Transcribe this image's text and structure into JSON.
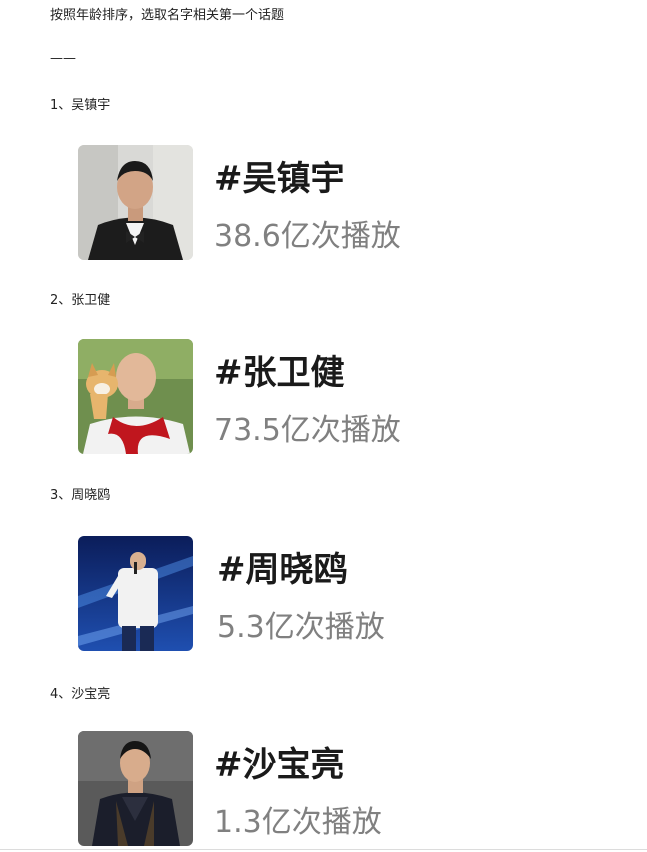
{
  "intro_text": "按照年龄排序，选取名字相关第一个话题",
  "divider_text": "——",
  "items": [
    {
      "label": "1、吴镇宇",
      "topic": "#吴镇宇",
      "plays": "38.6亿次播放",
      "photo_icon": "man-in-tuxedo-portrait"
    },
    {
      "label": "2、张卫健",
      "topic": "#张卫健",
      "plays": "73.5亿次播放",
      "photo_icon": "bald-man-with-dog-portrait"
    },
    {
      "label": "3、周晓鸥",
      "topic": "#周晓鸥",
      "plays": "5.3亿次播放",
      "photo_icon": "singer-on-stage-photo"
    },
    {
      "label": "4、沙宝亮",
      "topic": "#沙宝亮",
      "plays": "1.3亿次播放",
      "photo_icon": "man-in-vest-portrait"
    }
  ]
}
